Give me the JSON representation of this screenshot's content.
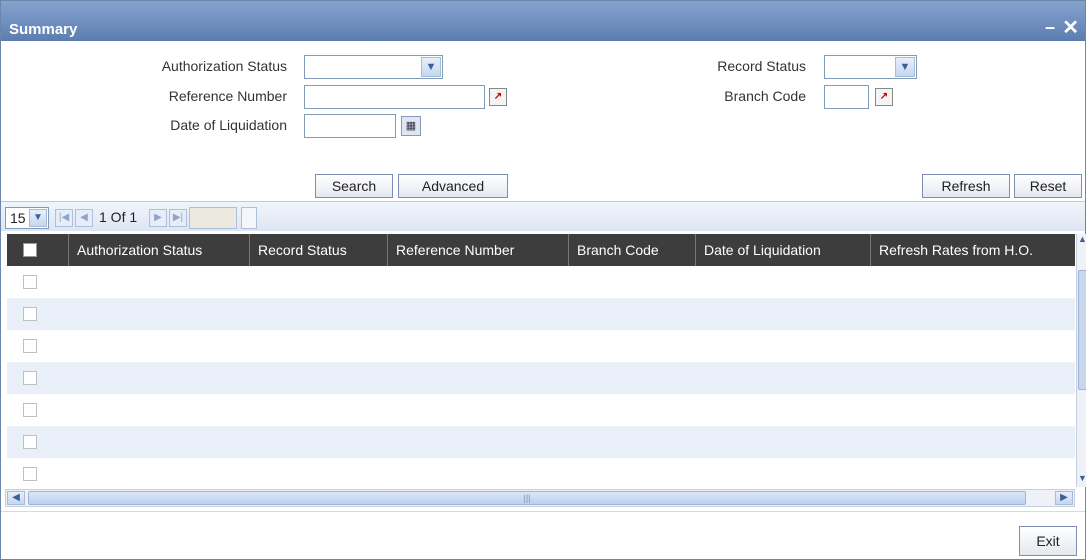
{
  "window": {
    "title": "Summary",
    "minimize_glyph": "–",
    "close_glyph": "✕"
  },
  "form": {
    "authorization_status": {
      "label": "Authorization Status",
      "value": ""
    },
    "record_status": {
      "label": "Record Status",
      "value": ""
    },
    "reference_number": {
      "label": "Reference Number",
      "value": ""
    },
    "branch_code": {
      "label": "Branch Code",
      "value": ""
    },
    "date_of_liquidation": {
      "label": "Date of Liquidation",
      "value": ""
    }
  },
  "buttons": {
    "search": "Search",
    "advanced": "Advanced",
    "refresh": "Refresh",
    "reset": "Reset",
    "exit": "Exit"
  },
  "pagination": {
    "page_size": "15",
    "page_text": "1 Of 1"
  },
  "grid": {
    "columns": [
      "Authorization Status",
      "Record Status",
      "Reference Number",
      "Branch Code",
      "Date of Liquidation",
      "Refresh Rates from H.O."
    ],
    "rows": []
  },
  "icons": {
    "select_arrow": "chevron-down-icon",
    "lov": "list-of-values-icon",
    "calendar": "calendar-icon",
    "first_page": "first-page-icon",
    "prev_page": "previous-page-icon",
    "next_page": "next-page-icon",
    "last_page": "last-page-icon"
  },
  "colors": {
    "titlebar": "#6f8fc2",
    "grid_header": "#3d3d3d",
    "row_alt": "#e9f0fa"
  }
}
